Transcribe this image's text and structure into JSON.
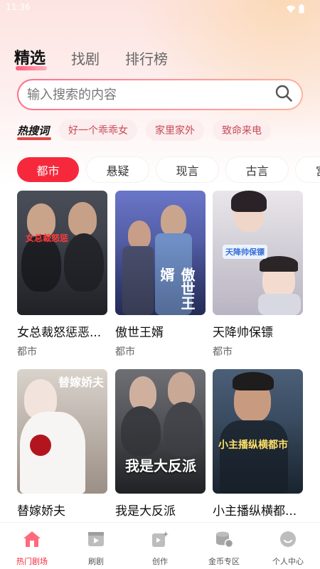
{
  "status_bar": {
    "time": "11:36"
  },
  "top_tabs": [
    {
      "label": "精选",
      "active": true
    },
    {
      "label": "找剧",
      "active": false
    },
    {
      "label": "排行榜",
      "active": false
    }
  ],
  "search": {
    "placeholder": "输入搜索的内容",
    "value": ""
  },
  "hot_words": {
    "label": "热搜词",
    "items": [
      "好一个乖乖女",
      "家里家外",
      "致命来电"
    ]
  },
  "categories": [
    {
      "label": "都市",
      "active": true
    },
    {
      "label": "悬疑",
      "active": false
    },
    {
      "label": "现言",
      "active": false
    },
    {
      "label": "古言",
      "active": false
    },
    {
      "label": "宫",
      "active": false
    }
  ],
  "dramas": [
    {
      "title": "女总裁怒惩恶...",
      "tag": "都市",
      "poster_text": "女总裁怒惩",
      "colors": [
        "#4a4e58",
        "#2a2c33"
      ]
    },
    {
      "title": "傲世王婿",
      "tag": "都市",
      "poster_text": "傲世王婿",
      "colors": [
        "#6a76c8",
        "#2f3a72"
      ]
    },
    {
      "title": "天降帅保镖",
      "tag": "都市",
      "poster_text": "天降帅保镖",
      "colors": [
        "#e9e6ea",
        "#b9b4c2"
      ]
    },
    {
      "title": "替嫁娇夫",
      "tag": "",
      "poster_text": "替嫁娇夫",
      "colors": [
        "#d9d3cc",
        "#9b8f86"
      ]
    },
    {
      "title": "我是大反派",
      "tag": "",
      "poster_text": "我是大反派",
      "colors": [
        "#6e6f74",
        "#2c2d31"
      ]
    },
    {
      "title": "小主播纵横都...",
      "tag": "",
      "poster_text": "小主播纵横都市",
      "colors": [
        "#4b5f78",
        "#22303f"
      ]
    }
  ],
  "bottom_nav": [
    {
      "label": "热门剧场",
      "icon": "home-icon",
      "active": true
    },
    {
      "label": "刷剧",
      "icon": "video-icon",
      "active": false
    },
    {
      "label": "创作",
      "icon": "create-icon",
      "active": false
    },
    {
      "label": "金币专区",
      "icon": "coin-icon",
      "active": false
    },
    {
      "label": "个人中心",
      "icon": "profile-icon",
      "active": false
    }
  ],
  "colors": {
    "accent": "#f5293b",
    "hot_chip_bg": "#fcedee",
    "hot_chip_text": "#c64a55"
  }
}
